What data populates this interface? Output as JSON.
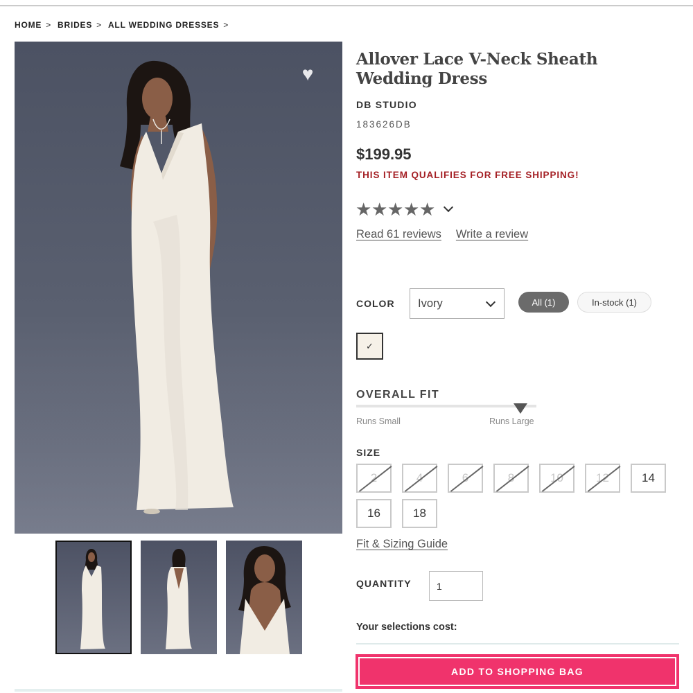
{
  "breadcrumb": [
    "HOME",
    "BRIDES",
    "ALL WEDDING DRESSES"
  ],
  "breadcrumb_separator": ">",
  "product": {
    "title": "Allover Lace V-Neck Sheath Wedding Dress",
    "brand": "DB STUDIO",
    "sku": "183626DB",
    "price": "$199.95",
    "shipping_note": "THIS ITEM QUALIFIES FOR FREE SHIPPING!",
    "rating_stars": 5
  },
  "reviews": {
    "read_label": "Read 61 reviews",
    "write_label": "Write a review"
  },
  "color": {
    "label": "COLOR",
    "selected": "Ivory",
    "filter_all": "All (1)",
    "filter_instock": "In-stock (1)",
    "swatch_check": "✓",
    "swatch_color": "#f6f1e8"
  },
  "fit": {
    "label": "OVERALL FIT",
    "left_label": "Runs Small",
    "right_label": "Runs Large",
    "position_fraction": 0.91
  },
  "size": {
    "label": "SIZE",
    "options": [
      {
        "value": "2",
        "available": false
      },
      {
        "value": "4",
        "available": false
      },
      {
        "value": "6",
        "available": false
      },
      {
        "value": "8",
        "available": false
      },
      {
        "value": "10",
        "available": false
      },
      {
        "value": "12",
        "available": false
      },
      {
        "value": "14",
        "available": true
      },
      {
        "value": "16",
        "available": true
      },
      {
        "value": "18",
        "available": true
      }
    ],
    "guide_label": "Fit & Sizing Guide"
  },
  "quantity": {
    "label": "QUANTITY",
    "value": "1"
  },
  "cost_label": "Your selections cost:",
  "add_to_bag_label": "ADD TO SHOPPING BAG",
  "colors": {
    "accent": "#f0336c",
    "shipping_red": "#a41f24",
    "photo_background": "#555b6b"
  },
  "icons": {
    "favorite": "heart-icon",
    "star": "star-icon",
    "dropdown": "chevron-down-icon"
  }
}
